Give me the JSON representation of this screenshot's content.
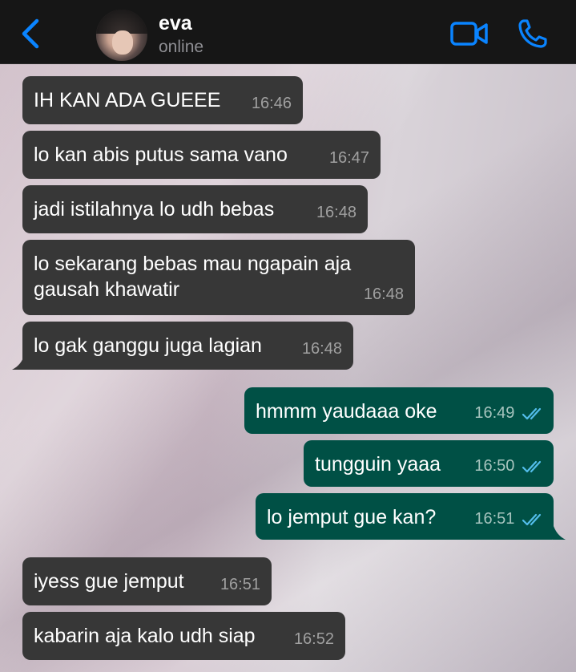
{
  "header": {
    "contact_name": "eva",
    "status": "online"
  },
  "messages": [
    {
      "direction": "in",
      "text": "IH KAN ADA GUEEE",
      "time": "16:46"
    },
    {
      "direction": "in",
      "text": "lo kan abis putus sama vano",
      "time": "16:47"
    },
    {
      "direction": "in",
      "text": "jadi istilahnya lo udh bebas",
      "time": "16:48"
    },
    {
      "direction": "in",
      "text": "lo sekarang bebas mau ngapain aja\ngausah khawatir",
      "time": "16:48"
    },
    {
      "direction": "in",
      "text": "lo gak ganggu juga lagian",
      "time": "16:48"
    },
    {
      "direction": "out",
      "text": "hmmm yaudaaa oke",
      "time": "16:49",
      "read": true
    },
    {
      "direction": "out",
      "text": "tungguin yaaa",
      "time": "16:50",
      "read": true
    },
    {
      "direction": "out",
      "text": "lo jemput gue kan?",
      "time": "16:51",
      "read": true
    },
    {
      "direction": "in",
      "text": "iyess gue jemput",
      "time": "16:51"
    },
    {
      "direction": "in",
      "text": "kabarin aja kalo udh siap",
      "time": "16:52"
    }
  ],
  "colors": {
    "header_bg": "#161616",
    "accent_blue": "#0a84ff",
    "incoming_bubble": "#373737",
    "outgoing_bubble": "#005045",
    "read_ticks": "#53bdeb"
  },
  "icons": [
    "chevron-left-icon",
    "video-camera-icon",
    "phone-icon",
    "double-check-icon"
  ]
}
